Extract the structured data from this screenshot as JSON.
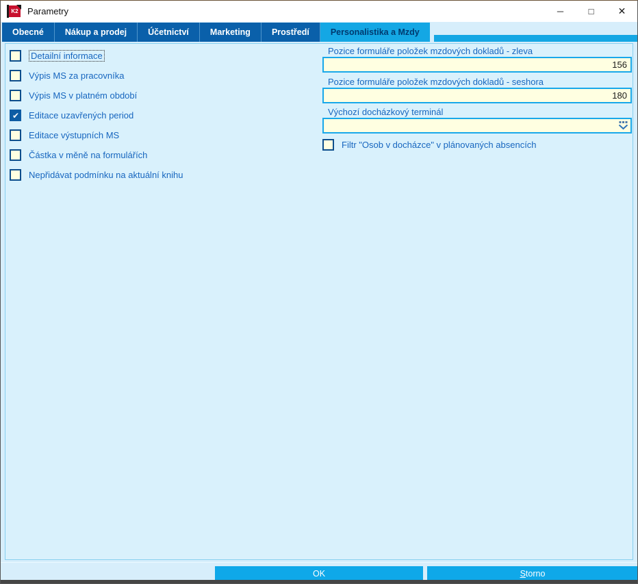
{
  "window": {
    "title": "Parametry",
    "icon_label": "K2",
    "controls": {
      "minimize": "─",
      "maximize": "□",
      "close": "✕"
    }
  },
  "tabs": [
    {
      "label": "Obecné",
      "active": false
    },
    {
      "label": "Nákup a prodej",
      "active": false
    },
    {
      "label": "Účetnictví",
      "active": false
    },
    {
      "label": "Marketing",
      "active": false
    },
    {
      "label": "Prostředí",
      "active": false
    },
    {
      "label": "Personalistika a Mzdy",
      "active": true
    }
  ],
  "left_panel": {
    "checkboxes": [
      {
        "label": "Detailní informace",
        "checked": false,
        "focused": true
      },
      {
        "label": "Výpis MS za pracovníka",
        "checked": false
      },
      {
        "label": "Výpis MS v platném období",
        "checked": false
      },
      {
        "label": "Editace uzavřených period",
        "checked": true
      },
      {
        "label": "Editace výstupních MS",
        "checked": false
      },
      {
        "label": "Částka v měně na formulářích",
        "checked": false
      },
      {
        "label": "Nepřidávat podmínku na aktuální knihu",
        "checked": false
      }
    ]
  },
  "right_panel": {
    "fields": [
      {
        "label": "Pozice formuláře položek mzdových dokladů - zleva",
        "value": "156"
      },
      {
        "label": "Pozice formuláře položek mzdových dokladů - seshora",
        "value": "180"
      },
      {
        "label": "Výchozí docházkový terminál",
        "value": ""
      }
    ],
    "checkbox": {
      "label": "Filtr \"Osob v docházce\" v plánovaných absencích",
      "checked": false
    }
  },
  "buttons": {
    "ok": "OK",
    "storno_accel": "S",
    "storno_rest": "torno"
  },
  "colors": {
    "accent": "#14A7E4",
    "tab_inactive": "#0A60AA",
    "input_bg": "#FFFFE1",
    "input_border": "#18A8EA",
    "label_blue": "#1766BF",
    "panel_bg": "#D9F1FC",
    "button": "#0FA8E9",
    "checkbox_checked": "#0E5CA4",
    "bottom_strip": "#454545"
  }
}
